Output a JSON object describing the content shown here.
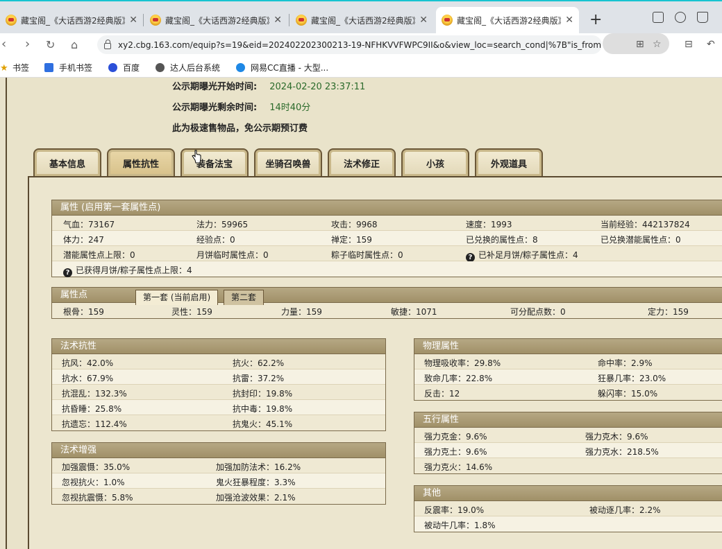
{
  "browser": {
    "tabs": [
      {
        "title": "藏宝阁_《大话西游2经典版》",
        "active": false
      },
      {
        "title": "藏宝阁_《大话西游2经典版》",
        "active": false
      },
      {
        "title": "藏宝阁_《大话西游2经典版》",
        "active": false
      },
      {
        "title": "藏宝阁_《大话西游2经典版》",
        "active": true
      }
    ],
    "close_glyph": "✕",
    "new_tab": "+",
    "url": "xy2.cbg.163.com/equip?s=19&eid=202402202300213-19-NFHKVVFWPC9II&o&view_loc=search_cond|%7B\"is_from_a...",
    "bookmarks": [
      "书签",
      "手机书签",
      "百度",
      "达人后台系统",
      "网易CC直播 - 大型..."
    ]
  },
  "info": {
    "expose_start_label": "公示期曝光开始时间:",
    "expose_start_value": "2024-02-20 23:37:11",
    "expose_remain_label": "公示期曝光剩余时间:",
    "expose_remain_value": "14时40分",
    "notice": "此为极速售物品，免公示期预订费"
  },
  "page_tabs": [
    "基本信息",
    "属性抗性",
    "装备法宝",
    "坐骑召唤兽",
    "法术修正",
    "小孩",
    "外观道具"
  ],
  "attributes": {
    "title": "属性 (启用第一套属性点)",
    "rows": [
      [
        "气血：73167",
        "法力：59965",
        "攻击：9968",
        "速度：1993",
        "当前经验：442137824"
      ],
      [
        "体力：247",
        "经验点：0",
        "禅定：159",
        "已兑换的属性点：8",
        "已兑换潜能属性点：0"
      ],
      [
        "潜能属性点上限：0",
        "月饼临时属性点：0",
        "粽子临时属性点：0",
        "已补足月饼/粽子属性点：4",
        ""
      ],
      [
        "已获得月饼/粽子属性点上限：4",
        "",
        "",
        "",
        ""
      ]
    ]
  },
  "points": {
    "title": "属性点",
    "tab1": "第一套 (当前启用)",
    "tab2": "第二套",
    "values": [
      "根骨：159",
      "灵性：159",
      "力量：159",
      "敏捷：1071",
      "可分配点数：0",
      "定力：159"
    ]
  },
  "resist": {
    "title": "法术抗性",
    "rows": [
      [
        "抗风：42.0%",
        "抗火：62.2%"
      ],
      [
        "抗水：67.9%",
        "抗雷：37.2%"
      ],
      [
        "抗混乱：132.3%",
        "抗封印：19.8%"
      ],
      [
        "抗昏睡：25.8%",
        "抗中毒：19.8%"
      ],
      [
        "抗遗忘：112.4%",
        "抗鬼火：45.1%"
      ]
    ]
  },
  "enhance": {
    "title": "法术增强",
    "rows": [
      [
        "加强震慑：35.0%",
        "加强加防法术：16.2%"
      ],
      [
        "忽视抗火：1.0%",
        "鬼火狂暴程度：3.3%"
      ],
      [
        "忽视抗震慑：5.8%",
        "加强沧波效果：2.1%"
      ]
    ]
  },
  "physical": {
    "title": "物理属性",
    "rows": [
      [
        "物理吸收率：29.8%",
        "命中率：2.9%"
      ],
      [
        "致命几率：22.8%",
        "狂暴几率：23.0%"
      ],
      [
        "反击：12",
        "躲闪率：15.0%"
      ]
    ]
  },
  "elements": {
    "title": "五行属性",
    "rows": [
      [
        "强力克金：9.6%",
        "强力克木：9.6%"
      ],
      [
        "强力克土：9.6%",
        "强力克水：218.5%"
      ],
      [
        "强力克火：14.6%",
        ""
      ]
    ]
  },
  "other": {
    "title": "其他",
    "rows": [
      [
        "反震率：19.0%",
        "被动逐几率：2.2%"
      ],
      [
        "被动牛几率：1.8%",
        ""
      ]
    ]
  },
  "help_glyph": "?",
  "colors": {
    "accent_top": "#17c4d0",
    "header_bg": "#a89a72",
    "value_green": "#2a6a2a"
  }
}
